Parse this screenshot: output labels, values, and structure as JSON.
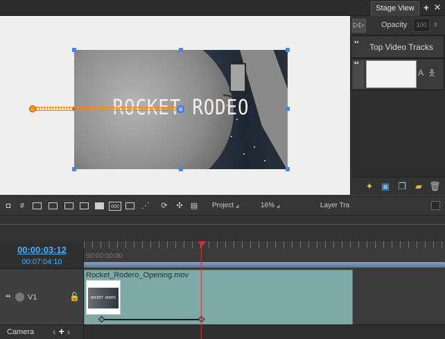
{
  "tabs": {
    "stage_view": "Stage View"
  },
  "stage": {
    "video_title": "ROCKET RODEO"
  },
  "right_panel": {
    "opacity_label": "Opacity",
    "opacity_value": "100",
    "tracks": [
      {
        "label": "Top Video Tracks"
      },
      {
        "label": "A"
      }
    ]
  },
  "toolbar": {
    "project_label": "Project",
    "zoom_label": "16%",
    "layer_label": "Layer Tra"
  },
  "timeline": {
    "current_time": "00:00:03:12",
    "duration": "00:07:04:10",
    "ruler_start": "00:00:00:00",
    "track_label": "V1",
    "clip_name": "Rocket_Rodero_Opening.mov",
    "clip_thumb_text": "ROCKET RODEO",
    "camera_label": "Camera"
  },
  "colors": {
    "accent": "#4ab0ff",
    "playhead": "#d03030",
    "clip": "#7fa9a7",
    "motion_path": "#f08a1c",
    "handle": "#4a86e8"
  }
}
